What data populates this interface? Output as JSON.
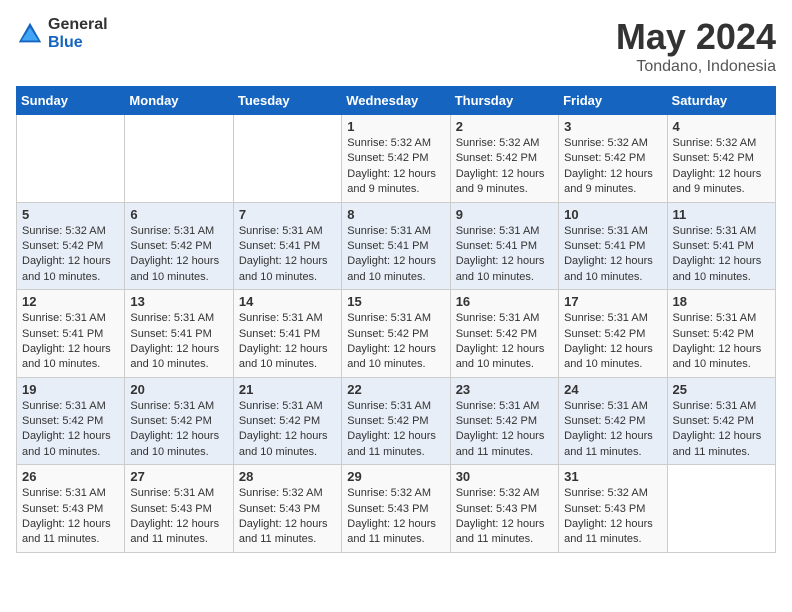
{
  "logo": {
    "general": "General",
    "blue": "Blue"
  },
  "title": "May 2024",
  "subtitle": "Tondano, Indonesia",
  "days_of_week": [
    "Sunday",
    "Monday",
    "Tuesday",
    "Wednesday",
    "Thursday",
    "Friday",
    "Saturday"
  ],
  "weeks": [
    [
      {
        "num": "",
        "info": ""
      },
      {
        "num": "",
        "info": ""
      },
      {
        "num": "",
        "info": ""
      },
      {
        "num": "1",
        "info": "Sunrise: 5:32 AM\nSunset: 5:42 PM\nDaylight: 12 hours and 9 minutes."
      },
      {
        "num": "2",
        "info": "Sunrise: 5:32 AM\nSunset: 5:42 PM\nDaylight: 12 hours and 9 minutes."
      },
      {
        "num": "3",
        "info": "Sunrise: 5:32 AM\nSunset: 5:42 PM\nDaylight: 12 hours and 9 minutes."
      },
      {
        "num": "4",
        "info": "Sunrise: 5:32 AM\nSunset: 5:42 PM\nDaylight: 12 hours and 9 minutes."
      }
    ],
    [
      {
        "num": "5",
        "info": "Sunrise: 5:32 AM\nSunset: 5:42 PM\nDaylight: 12 hours and 10 minutes."
      },
      {
        "num": "6",
        "info": "Sunrise: 5:31 AM\nSunset: 5:42 PM\nDaylight: 12 hours and 10 minutes."
      },
      {
        "num": "7",
        "info": "Sunrise: 5:31 AM\nSunset: 5:41 PM\nDaylight: 12 hours and 10 minutes."
      },
      {
        "num": "8",
        "info": "Sunrise: 5:31 AM\nSunset: 5:41 PM\nDaylight: 12 hours and 10 minutes."
      },
      {
        "num": "9",
        "info": "Sunrise: 5:31 AM\nSunset: 5:41 PM\nDaylight: 12 hours and 10 minutes."
      },
      {
        "num": "10",
        "info": "Sunrise: 5:31 AM\nSunset: 5:41 PM\nDaylight: 12 hours and 10 minutes."
      },
      {
        "num": "11",
        "info": "Sunrise: 5:31 AM\nSunset: 5:41 PM\nDaylight: 12 hours and 10 minutes."
      }
    ],
    [
      {
        "num": "12",
        "info": "Sunrise: 5:31 AM\nSunset: 5:41 PM\nDaylight: 12 hours and 10 minutes."
      },
      {
        "num": "13",
        "info": "Sunrise: 5:31 AM\nSunset: 5:41 PM\nDaylight: 12 hours and 10 minutes."
      },
      {
        "num": "14",
        "info": "Sunrise: 5:31 AM\nSunset: 5:41 PM\nDaylight: 12 hours and 10 minutes."
      },
      {
        "num": "15",
        "info": "Sunrise: 5:31 AM\nSunset: 5:42 PM\nDaylight: 12 hours and 10 minutes."
      },
      {
        "num": "16",
        "info": "Sunrise: 5:31 AM\nSunset: 5:42 PM\nDaylight: 12 hours and 10 minutes."
      },
      {
        "num": "17",
        "info": "Sunrise: 5:31 AM\nSunset: 5:42 PM\nDaylight: 12 hours and 10 minutes."
      },
      {
        "num": "18",
        "info": "Sunrise: 5:31 AM\nSunset: 5:42 PM\nDaylight: 12 hours and 10 minutes."
      }
    ],
    [
      {
        "num": "19",
        "info": "Sunrise: 5:31 AM\nSunset: 5:42 PM\nDaylight: 12 hours and 10 minutes."
      },
      {
        "num": "20",
        "info": "Sunrise: 5:31 AM\nSunset: 5:42 PM\nDaylight: 12 hours and 10 minutes."
      },
      {
        "num": "21",
        "info": "Sunrise: 5:31 AM\nSunset: 5:42 PM\nDaylight: 12 hours and 10 minutes."
      },
      {
        "num": "22",
        "info": "Sunrise: 5:31 AM\nSunset: 5:42 PM\nDaylight: 12 hours and 11 minutes."
      },
      {
        "num": "23",
        "info": "Sunrise: 5:31 AM\nSunset: 5:42 PM\nDaylight: 12 hours and 11 minutes."
      },
      {
        "num": "24",
        "info": "Sunrise: 5:31 AM\nSunset: 5:42 PM\nDaylight: 12 hours and 11 minutes."
      },
      {
        "num": "25",
        "info": "Sunrise: 5:31 AM\nSunset: 5:42 PM\nDaylight: 12 hours and 11 minutes."
      }
    ],
    [
      {
        "num": "26",
        "info": "Sunrise: 5:31 AM\nSunset: 5:43 PM\nDaylight: 12 hours and 11 minutes."
      },
      {
        "num": "27",
        "info": "Sunrise: 5:31 AM\nSunset: 5:43 PM\nDaylight: 12 hours and 11 minutes."
      },
      {
        "num": "28",
        "info": "Sunrise: 5:32 AM\nSunset: 5:43 PM\nDaylight: 12 hours and 11 minutes."
      },
      {
        "num": "29",
        "info": "Sunrise: 5:32 AM\nSunset: 5:43 PM\nDaylight: 12 hours and 11 minutes."
      },
      {
        "num": "30",
        "info": "Sunrise: 5:32 AM\nSunset: 5:43 PM\nDaylight: 12 hours and 11 minutes."
      },
      {
        "num": "31",
        "info": "Sunrise: 5:32 AM\nSunset: 5:43 PM\nDaylight: 12 hours and 11 minutes."
      },
      {
        "num": "",
        "info": ""
      }
    ]
  ]
}
